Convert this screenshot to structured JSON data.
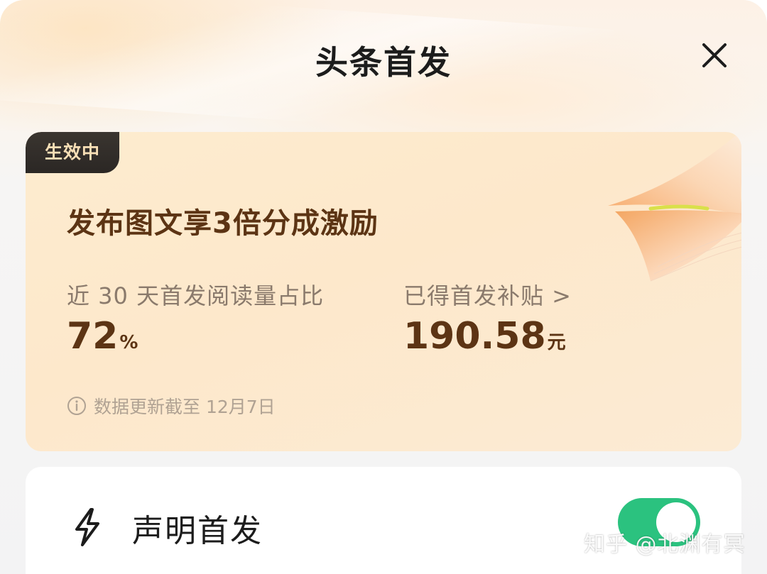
{
  "header": {
    "title": "头条首发",
    "close_icon": "close-icon"
  },
  "card": {
    "badge": "生效中",
    "headline": "发布图文享3倍分成激励",
    "read_share": {
      "label": "近 30 天首发阅读量占比",
      "value": "72",
      "unit": "%"
    },
    "subsidy": {
      "label": "已得首发补贴 >",
      "value": "190.58",
      "unit": "元"
    },
    "footnote": "数据更新截至 12月7日",
    "colors": {
      "background": "#fdeccf",
      "accent_text": "#5c3414"
    }
  },
  "declare": {
    "label": "声明首发",
    "icon": "lightning-icon",
    "toggle_on": true,
    "toggle_color": "#2bc27f"
  },
  "watermark": "知乎 @北渊有冥"
}
